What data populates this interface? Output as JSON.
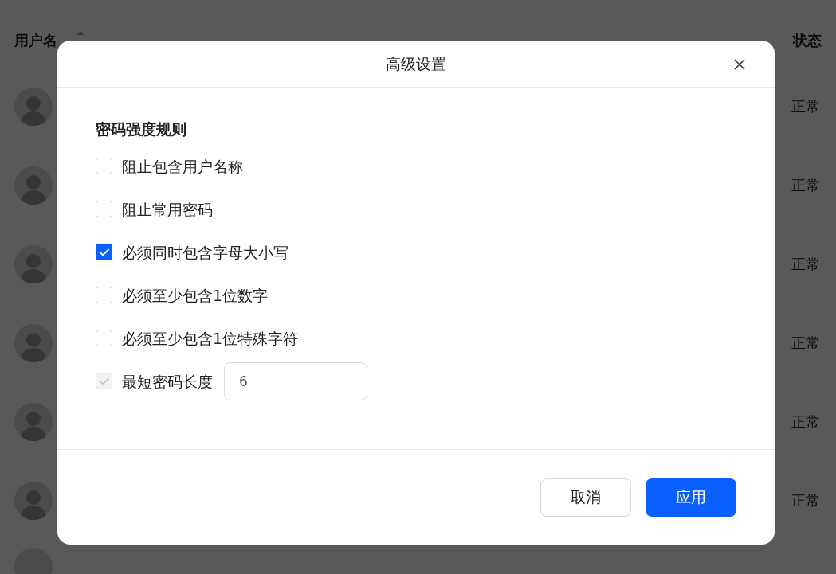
{
  "table": {
    "columns": [
      {
        "label": "用户名",
        "sortable": true
      },
      {
        "label": "状态",
        "sortable": false
      }
    ],
    "rows": [
      {
        "status": "正常"
      },
      {
        "status": "正常"
      },
      {
        "status": "正常"
      },
      {
        "status": "正常"
      },
      {
        "status": "正常"
      },
      {
        "status": "正常"
      }
    ]
  },
  "dialog": {
    "title": "高级设置",
    "section_title": "密码强度规则",
    "rules": [
      {
        "kind": "checkbox",
        "label": "阻止包含用户名称",
        "checked": false,
        "disabled": false
      },
      {
        "kind": "checkbox",
        "label": "阻止常用密码",
        "checked": false,
        "disabled": false
      },
      {
        "kind": "checkbox",
        "label": "必须同时包含字母大小写",
        "checked": true,
        "disabled": false
      },
      {
        "kind": "checkbox",
        "label": "必须至少包含1位数字",
        "checked": false,
        "disabled": false
      },
      {
        "kind": "checkbox",
        "label": "必须至少包含1位特殊字符",
        "checked": false,
        "disabled": false
      },
      {
        "kind": "checkbox-with-input",
        "label": "最短密码长度",
        "checked": true,
        "disabled": true,
        "value": "6"
      }
    ],
    "buttons": [
      {
        "kind": "secondary",
        "label": "取消"
      },
      {
        "kind": "primary",
        "label": "应用"
      }
    ]
  }
}
